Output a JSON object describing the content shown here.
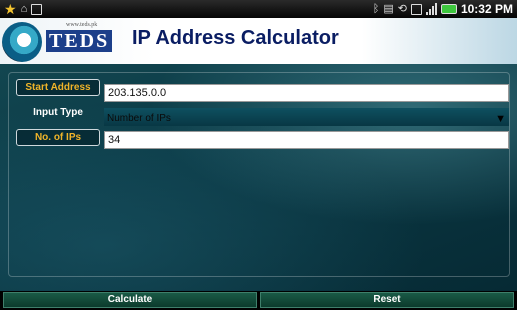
{
  "status_bar": {
    "time": "10:32",
    "ampm": "PM",
    "icons": [
      "star-icon",
      "alarm-icon",
      "screenshot-icon",
      "bluetooth-icon",
      "vibrate-icon",
      "sdcard-icon",
      "signal-icon",
      "battery-icon"
    ]
  },
  "header": {
    "logo_text": "TEDS",
    "logo_url": "www.teds.pk",
    "title": "IP Address Calculator"
  },
  "form": {
    "start_address_label": "Start Address",
    "start_address_value": "203.135.0.0",
    "input_type_label": "Input Type",
    "input_type_value": "Number of IPs",
    "num_ips_label": "No. of IPs",
    "num_ips_value": "34"
  },
  "actions": {
    "calculate_label": "Calculate",
    "reset_label": "Reset"
  },
  "colors": {
    "label_gold": "#f0b429",
    "title_navy": "#0a1d63",
    "panel_teal": "#0b3a46"
  }
}
